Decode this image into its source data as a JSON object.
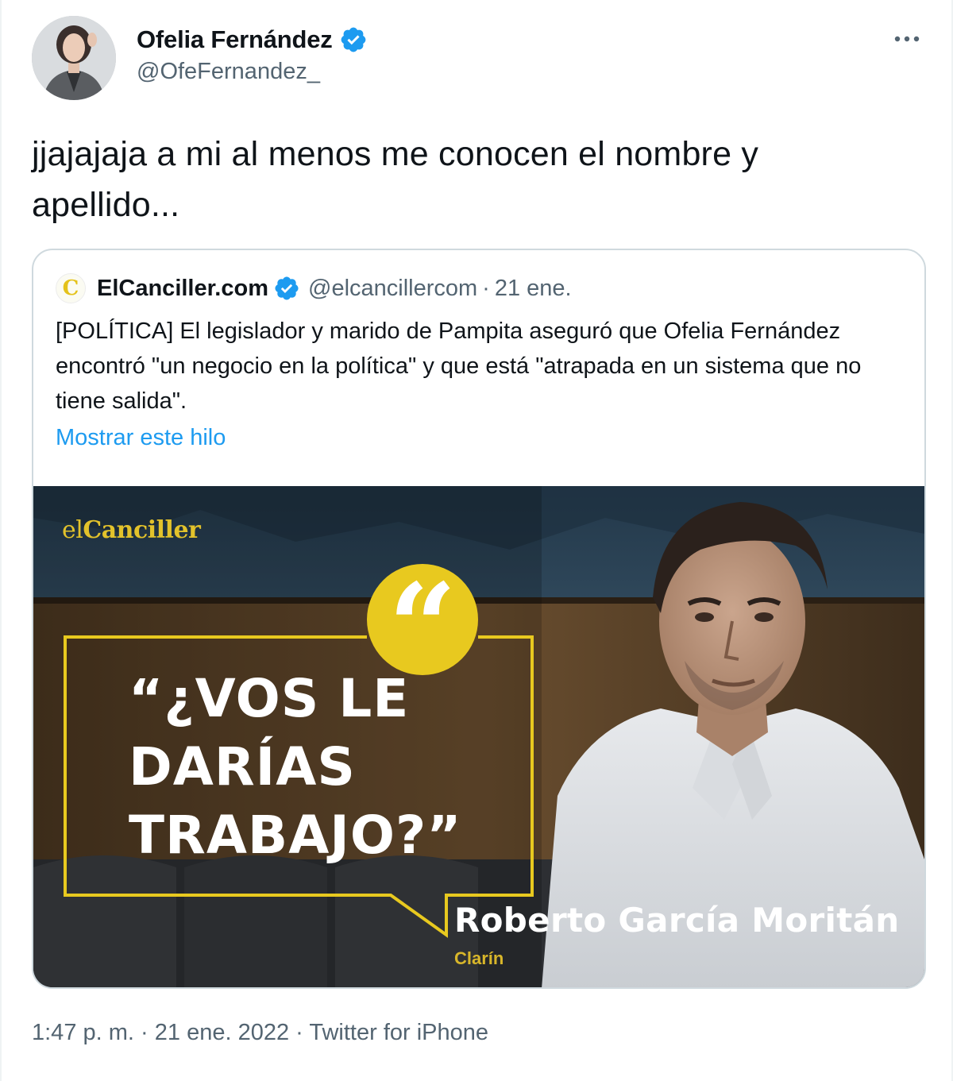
{
  "author": {
    "display_name": "Ofelia Fernández",
    "handle": "@OfeFernandez_",
    "verified_icon": "verified-badge-icon"
  },
  "tweet": {
    "text": "jjajajaja a mi al menos me conocen el nombre y apellido..."
  },
  "quoted_tweet": {
    "display_name": "ElCanciller.com",
    "handle": "@elcancillercom",
    "separator": "·",
    "date": "21 ene.",
    "avatar_letter": "C",
    "text": "[POLÍTICA] El legislador y marido de Pampita aseguró que Ofelia Fernández encontró \"un negocio en la política\" y que está \"atrapada en un sistema que no tiene salida\".",
    "show_thread_label": "Mostrar este hilo",
    "media": {
      "logo_prefix": "el",
      "logo_main": "Canciller",
      "quote_mark": "“",
      "headline": "“¿VOS LE DARÍAS TRABAJO?”",
      "person_name": "Roberto García Moritán",
      "source": "Clarín"
    }
  },
  "footer": {
    "time": "1:47 p. m.",
    "separator1": "·",
    "date": "21 ene. 2022",
    "separator2": "·",
    "client": "Twitter for iPhone"
  },
  "colors": {
    "link_blue": "#1d9bf0",
    "verified_blue": "#1d9bf0",
    "secondary_text": "#536471",
    "brand_yellow": "#e8c91f"
  }
}
